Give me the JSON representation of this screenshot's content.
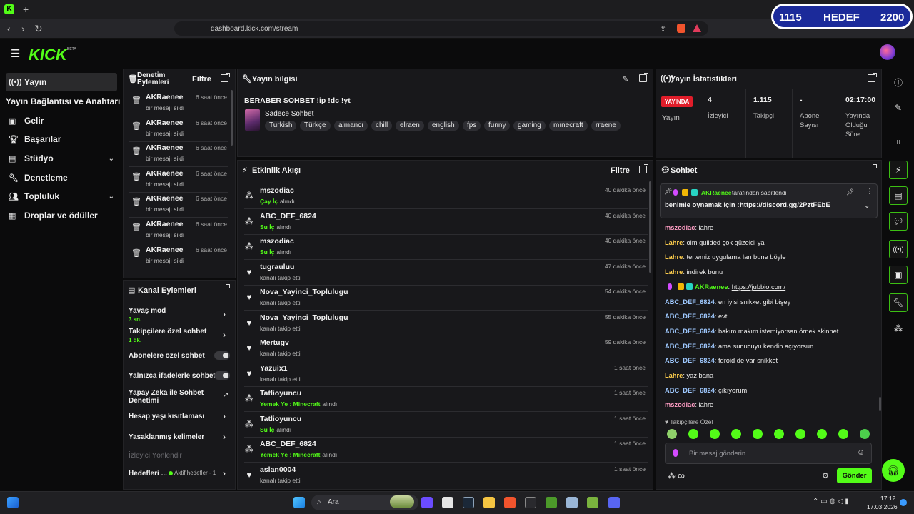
{
  "browser": {
    "url": "dashboard.kick.com/stream",
    "new_tab": "+"
  },
  "hedef": {
    "current": "1115",
    "label": "HEDEF",
    "target": "2200"
  },
  "app": {
    "logo": "KICK",
    "logo_sup": "BETA"
  },
  "sidebar": {
    "items": [
      {
        "label": "Yayın"
      },
      {
        "label": "Yayın Bağlantısı ve Anahtarı"
      },
      {
        "label": "Gelir"
      },
      {
        "label": "Başarılar"
      },
      {
        "label": "Stüdyo"
      },
      {
        "label": "Denetleme"
      },
      {
        "label": "Topluluk"
      },
      {
        "label": "Droplar ve ödüller"
      }
    ]
  },
  "denetim": {
    "title": "Denetim Eylemleri",
    "filter": "Filtre",
    "rows": [
      {
        "name": "AKRaenee",
        "action": "bir mesajı sildi",
        "time": "6 saat önce"
      },
      {
        "name": "AKRaenee",
        "action": "bir mesajı sildi",
        "time": "6 saat önce"
      },
      {
        "name": "AKRaenee",
        "action": "bir mesajı sildi",
        "time": "6 saat önce"
      },
      {
        "name": "AKRaenee",
        "action": "bir mesajı sildi",
        "time": "6 saat önce"
      },
      {
        "name": "AKRaenee",
        "action": "bir mesajı sildi",
        "time": "6 saat önce"
      },
      {
        "name": "AKRaenee",
        "action": "bir mesajı sildi",
        "time": "6 saat önce"
      },
      {
        "name": "AKRaenee",
        "action": "bir mesajı sildi",
        "time": "6 saat önce"
      }
    ]
  },
  "kanal": {
    "title": "Kanal Eylemleri",
    "rows": [
      {
        "label": "Yavaş mod",
        "sub": "3 sn."
      },
      {
        "label": "Takipçilere özel sohbet",
        "sub": "1 dk."
      },
      {
        "label": "Abonelere özel sohbet"
      },
      {
        "label": "Yalnızca ifadelerle sohbet"
      },
      {
        "label": "Yapay Zeka ile Sohbet Denetimi"
      },
      {
        "label": "Hesap yaşı kısıtlaması"
      },
      {
        "label": "Yasaklanmış kelimeler"
      },
      {
        "label": "İzleyici Yönlendir"
      },
      {
        "label": "Hedefleri ...",
        "extra": "Aktif hedefler - 1"
      }
    ]
  },
  "yayin_bilgisi": {
    "title": "Yayın bilgisi",
    "stream_title": "BERABER SOHBET !ip !dc !yt",
    "category": "Sadece Sohbet",
    "tags": [
      "Turkish",
      "Türkçe",
      "almancı",
      "chill",
      "elraen",
      "english",
      "fps",
      "funny",
      "gaming",
      "mınecraft",
      "rraene"
    ]
  },
  "etkinlik": {
    "title": "Etkinlik Akışı",
    "filter": "Filtre",
    "rows": [
      {
        "type": "reward",
        "name": "mszodiac",
        "reward": "Çay İç",
        "suffix": "alındı",
        "time": "40 dakika önce"
      },
      {
        "type": "reward",
        "name": "ABC_DEF_6824",
        "reward": "Su İç",
        "suffix": "alındı",
        "time": "40 dakika önce"
      },
      {
        "type": "reward",
        "name": "mszodiac",
        "reward": "Su İç",
        "suffix": "alındı",
        "time": "40 dakika önce"
      },
      {
        "type": "follow",
        "name": "tugrauluu",
        "text": "kanalı takip etti",
        "time": "47 dakika önce"
      },
      {
        "type": "follow",
        "name": "Nova_Yayinci_Toplulugu",
        "text": "kanalı takip etti",
        "time": "54 dakika önce"
      },
      {
        "type": "follow",
        "name": "Nova_Yayinci_Toplulugu",
        "text": "kanalı takip etti",
        "time": "55 dakika önce"
      },
      {
        "type": "follow",
        "name": "Mertugv",
        "text": "kanalı takip etti",
        "time": "59 dakika önce"
      },
      {
        "type": "follow",
        "name": "Yazuix1",
        "text": "kanalı takip etti",
        "time": "1 saat önce"
      },
      {
        "type": "reward",
        "name": "Tatlioyuncu",
        "reward": "Yemek Ye : Minecraft",
        "suffix": "alındı",
        "time": "1 saat önce"
      },
      {
        "type": "reward",
        "name": "Tatlioyuncu",
        "reward": "Su İç",
        "suffix": "alındı",
        "time": "1 saat önce"
      },
      {
        "type": "reward",
        "name": "ABC_DEF_6824",
        "reward": "Yemek Ye : Minecraft",
        "suffix": "alındı",
        "time": "1 saat önce"
      },
      {
        "type": "follow",
        "name": "aslan0004",
        "text": "kanalı takip etti",
        "time": "1 saat önce"
      }
    ]
  },
  "stats": {
    "title": "Yayın İstatistikleri",
    "live_badge": "YAYINDA",
    "live_label": "Yayın",
    "cells": [
      {
        "value": "4",
        "label": "İzleyici"
      },
      {
        "value": "1.115",
        "label": "Takipçi"
      },
      {
        "value": "-",
        "label": "Abone Sayısı"
      },
      {
        "value": "02:17:00",
        "label": "Yayında Olduğu Süre"
      }
    ]
  },
  "chat": {
    "title": "Sohbet",
    "pinned_by": "AKRaenee",
    "pinned_by_suffix": "tarafından sabitlendi",
    "pinned_text": "benimle oynamak için :",
    "pinned_link": "https://discord.gg/2PztFEbE",
    "messages": [
      {
        "user": "mszodiac",
        "cls": "u-ms",
        "text": "lahre"
      },
      {
        "user": "Lahre",
        "cls": "u-la",
        "text": "olm guilded çok güzeldi ya"
      },
      {
        "user": "Lahre",
        "cls": "u-la",
        "text": "tertemiz uygulama lan bune böyle"
      },
      {
        "user": "Lahre",
        "cls": "u-la",
        "text": "indirek bunu"
      },
      {
        "user": "AKRaenee",
        "cls": "u-ak",
        "text": "https://jubbio.com/",
        "badges": true
      },
      {
        "user": "ABC_DEF_6824",
        "cls": "u-ab",
        "text": "en iyisi snikket gibi bişey"
      },
      {
        "user": "ABC_DEF_6824",
        "cls": "u-ab",
        "text": "evt"
      },
      {
        "user": "ABC_DEF_6824",
        "cls": "u-ab",
        "text": "bakım makım istemiyorsan örnek skinnet"
      },
      {
        "user": "ABC_DEF_6824",
        "cls": "u-ab",
        "text": "ama sunucuyu kendin açıyorsun"
      },
      {
        "user": "ABC_DEF_6824",
        "cls": "u-ab",
        "text": "fdroid de var snikket"
      },
      {
        "user": "Lahre",
        "cls": "u-la",
        "text": "yaz bana"
      },
      {
        "user": "ABC_DEF_6824",
        "cls": "u-ab",
        "text": "çıkıyorum"
      },
      {
        "user": "mszodiac",
        "cls": "u-ms",
        "text": "lahre"
      }
    ],
    "emote_section": "Takipçilere Özel",
    "input_placeholder": "Bir mesaj gönderin",
    "send": "Gönder",
    "infinity": "∞"
  },
  "taskbar": {
    "search": "Ara",
    "time": "17:12",
    "date": "17.03.2026"
  },
  "colors": {
    "accent": "#53fc18",
    "live": "#e11d2a",
    "panel": "#18181b"
  }
}
